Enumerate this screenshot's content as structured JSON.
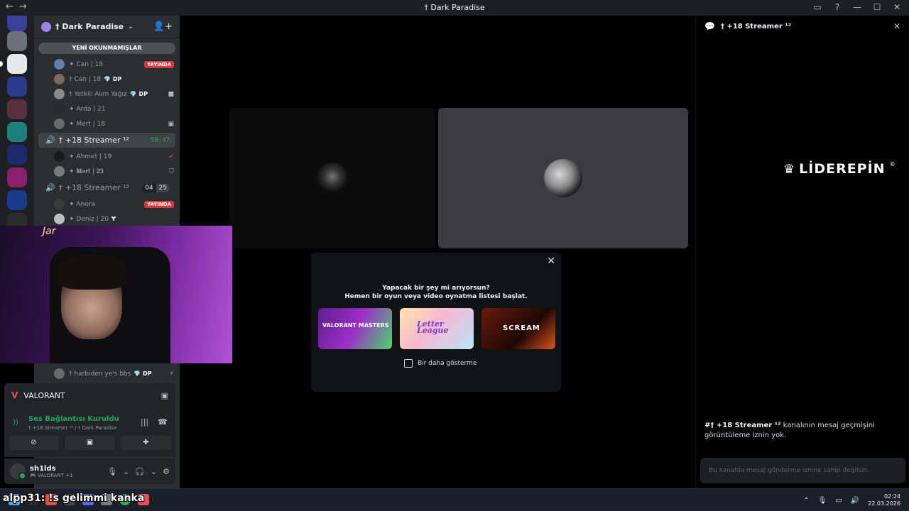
{
  "titlebar": {
    "title": "† Dark Paradise",
    "back": "←",
    "forward": "→",
    "inbox_icon": "▭",
    "help_icon": "?",
    "min_icon": "—",
    "max_icon": "☐",
    "close_icon": "✕"
  },
  "server": {
    "name": "† Dark Paradise",
    "chevron": "⌄",
    "unread_label": "YENİ OKUNMAMIŞLAR",
    "invite_icon": "👤+"
  },
  "voice_users_top": [
    {
      "name": "✦ Can | 18",
      "badge": "YAYINDA"
    },
    {
      "name": "† Can | 18",
      "tag": "💎 DP"
    },
    {
      "name": "† Yetkili Alım Yağız",
      "tag": "💎 DP",
      "icon": "■"
    },
    {
      "name": "✦ Arda | 21"
    },
    {
      "name": "✦ Mert | 18",
      "icon": "▣"
    }
  ],
  "channels": [
    {
      "name": "† +18 Streamer ¹²",
      "timer": "58:47"
    },
    {
      "name": "† +18 Streamer ¹³",
      "count_a": "04",
      "count_b": "25"
    }
  ],
  "voice_users_mid": [
    {
      "name": "✦ Ahmet | 19",
      "icon": "✔"
    },
    {
      "name": "✦ 𝐌𝐞𝐫𝐭 | 𝟐𝟑",
      "icon": "⛉"
    }
  ],
  "voice_users_bottom": [
    {
      "name": "✦ Anora",
      "badge": "YAYINDA"
    },
    {
      "name": "✦ Deniz | 20",
      "icon": "Ɏ"
    }
  ],
  "harbiden": {
    "name": "† harbiden ye's bbs",
    "tag": "💎 DP",
    "icon": "⚡"
  },
  "activity_panel": {
    "logo": "V",
    "game": "VALORANT",
    "icon": "▣"
  },
  "voice_panel": {
    "state": "Ses Bağlantısı Kuruldu",
    "where": "† +18 Streamer ¹² / † Dark Paradise",
    "signal": "))",
    "noise_icon": "|||",
    "hangup_icon": "☎",
    "btn_camera": "⊘",
    "btn_share": "▣",
    "btn_activity": "✚"
  },
  "user": {
    "name": "sh1lds",
    "status": "🎮 VALORANT +1",
    "mic_icon": "🎙",
    "headset_icon": "🎧",
    "settings_icon": "⚙",
    "caret": "⌄"
  },
  "activity_popup": {
    "close": "✕",
    "line1": "Yapacak bir şey mi arıyorsun?",
    "line2": "Hemen bir oyun veya video oynatma listesi başlat.",
    "cards": [
      {
        "label": "VALORANT MASTERS"
      },
      {
        "label": "Letter League"
      },
      {
        "label": "SCREAM"
      }
    ],
    "checkbox_label": "Bir daha gösterme"
  },
  "chat": {
    "title": "† +18 Streamer ¹²",
    "bubble_icon": "💬",
    "close": "✕",
    "watermark": "LİDEREPİN",
    "watermark_reg": "®",
    "notice_channel": "#† +18 Streamer ¹²",
    "notice_text": " kanalının mesaj geçmişini görüntüleme iznin yok.",
    "input_placeholder": "Bu kanalda mesaj gönderme iznine sahip değilsin."
  },
  "cam": {
    "neon": "Jar"
  },
  "taskbar": {
    "overlay_text": "alpp31: !s gelimmi kanka",
    "time": "02:24",
    "date": "22.03.2026",
    "tray_up": "⌃",
    "tray_mic": "🎙",
    "tray_net": "▭",
    "tray_vol": "🔊"
  },
  "colors": {
    "bg": "#000000",
    "sidebar": "#2b2d31",
    "green": "#23a55a",
    "live_red": "#da373c",
    "accent_purple": "#9b84ee"
  }
}
